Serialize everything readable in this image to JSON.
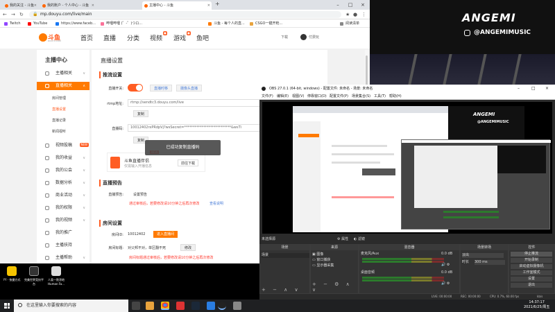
{
  "browser": {
    "tabs": [
      {
        "label": "我的关注 - 斗鱼"
      },
      {
        "label": "我的账户 - 个人中心 - 斗鱼"
      },
      {
        "label": "主播中心 - 斗鱼"
      }
    ],
    "url": "mp.douyu.com/live/main",
    "bookmarks": [
      "Twitch",
      "YouTube",
      "https://www.faceb...",
      "哔哩哔哩 (゜-゜)つロ...",
      "CSGO一键开枪...",
      "斗鱼 - 每个人的直...",
      "阅读清单"
    ]
  },
  "site": {
    "logo_text": "斗鱼",
    "logo_sub": "DOUYU.COM",
    "nav": [
      "首页",
      "直播",
      "分类",
      "视频",
      "游戏",
      "鱼吧"
    ],
    "download": "下载",
    "user": "付费玩"
  },
  "sidebar": {
    "title": "主播中心",
    "items": [
      {
        "label": "主播相关"
      },
      {
        "label": "直播相关"
      },
      {
        "label": "视频投稿"
      },
      {
        "label": "我的收益"
      },
      {
        "label": "我的公会"
      },
      {
        "label": "数据分析"
      },
      {
        "label": "商业活动"
      },
      {
        "label": "我的权限"
      },
      {
        "label": "我的视频"
      },
      {
        "label": "我的推广"
      },
      {
        "label": "主播扶持"
      },
      {
        "label": "主播帮助"
      }
    ],
    "subitems": [
      "房间管理",
      "直播设置",
      "直播记录",
      "新闻视听"
    ],
    "new_badge": "NEW"
  },
  "content": {
    "title": "直播设置",
    "section_stream": "推流设置",
    "live_switch_label": "直播开关:",
    "btn_time_shift": "直播时移",
    "btn_camera_live": "摄像头直播",
    "rtmp_label": "rtmp地址:",
    "rtmp_value": "rtmp://sendtc3.douyu.com/live",
    "copy": "复制",
    "code_label": "直播码:",
    "code_value": "10012402rxPRdpVj?wsSecret=***************************&wsTi",
    "promo_title": "斗鱼直播伴侣",
    "promo_sub": "仅需输入开播信息",
    "promo_new": "NEW",
    "promo_download": "前往下载",
    "toast": "已成功复制直播码",
    "section_preview": "直播预告",
    "preview_label": "直播预告:",
    "preview_value": "设置预告",
    "preview_note": "通过审核后，若要修改请10分钟之后再次修改",
    "preview_link": "查看说明",
    "section_room": "房间设置",
    "room_id_label": "房间ID:",
    "room_id": "10012402",
    "enter_room": "进入直播间",
    "room_name_label": "房间标题:",
    "room_name": "对父邦不对，单区翻不死",
    "modify": "修改",
    "room_note": "房间标题通过审核后，若要修改请10分钟之后再次修改"
  },
  "desktop": {
    "icons": [
      {
        "label": "YY - 快捷方式"
      },
      {
        "label": "完美世界竞技平台"
      },
      {
        "label": "人类一败涂地 Human Fa..."
      }
    ]
  },
  "camera": {
    "brand": "ANGEMI",
    "instagram": "@ANGEMIMUSIC"
  },
  "obs": {
    "title": "OBS 27.0.1 (64-bit, windows) - 配置文件: 未命名 - 场景: 未命名",
    "menu": [
      "文件(F)",
      "编辑(E)",
      "视图(V)",
      "停靠窗口(D)",
      "配置文件(P)",
      "场景集合(S)",
      "工具(T)",
      "帮助(H)"
    ],
    "mode_left": "未选择源",
    "mode_props": "属性",
    "mode_filters": "滤镜",
    "docks": {
      "scenes": "场景",
      "scene_items": [
        "场景"
      ],
      "sources": "来源",
      "source_items": [
        "图像",
        "窗口捕获",
        "显示器采集"
      ],
      "mixer": "混音器",
      "mixer_items": [
        {
          "name": "麦克风/Aux",
          "db": "0.0 dB"
        },
        {
          "name": "桌面音频",
          "db": "0.0 dB"
        }
      ],
      "transitions": "场景转场",
      "transition_type": "淡出",
      "duration_label": "时长",
      "duration": "300 ms",
      "controls": "控件",
      "control_items": [
        "停止推流",
        "开始录制",
        "启动虚拟摄像机",
        "工作室模式",
        "设置",
        "退出"
      ]
    },
    "status": {
      "live": "LIVE: 00:00:00",
      "rec": "REC: 00:00:00",
      "cpu": "CPU: 0.7%, 60.00 fps",
      "kbps": "kb/s"
    }
  },
  "taskbar": {
    "search_placeholder": "在这里输入你要搜索的内容",
    "time": "14:37:17",
    "date": "2021/6/25/周五"
  },
  "colors": {
    "douyu_orange": "#ff7a00",
    "douyu_red": "#ff5d23",
    "link_blue": "#4a7ed8",
    "obs_dark": "#2b2b2b"
  }
}
